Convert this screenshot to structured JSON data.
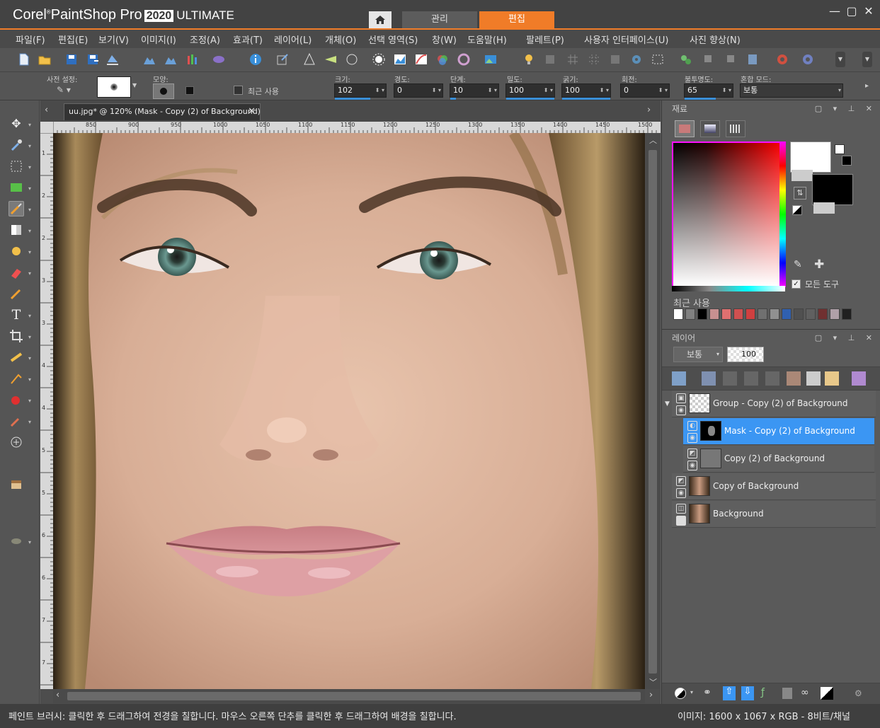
{
  "app": {
    "logo_corel": "Corel",
    "logo_product": "PaintShop Pro",
    "logo_year": "2020",
    "logo_edition": "ULTIMATE"
  },
  "workspace_tabs": {
    "manage": "관리",
    "edit": "편집"
  },
  "window_controls": {
    "minimize": "—",
    "maximize": "▢",
    "close": "✕"
  },
  "menu": [
    "파일(F)",
    "편집(E)",
    "보기(V)",
    "이미지(I)",
    "조정(A)",
    "효과(T)",
    "레이어(L)",
    "개체(O)",
    "선택 영역(S)",
    "창(W)",
    "도움말(H)",
    "팔레트(P)",
    "사용자 인터페이스(U)",
    "사진 향상(N)"
  ],
  "options": {
    "preset_label": "사전 설정:",
    "shape_label": "모양:",
    "recent_use_label": "최근 사용",
    "size_label": "크기:",
    "size_value": "102",
    "hardness_label": "경도:",
    "hardness_value": "0",
    "step_label": "단계:",
    "step_value": "10",
    "density_label": "밀도:",
    "density_value": "100",
    "thickness_label": "굵기:",
    "thickness_value": "100",
    "rotation_label": "회전:",
    "rotation_value": "0",
    "opacity_label": "불투명도:",
    "opacity_value": "65",
    "blend_label": "혼합 모드:",
    "blend_value": "보통"
  },
  "document": {
    "tab_title": "uu.jpg* @ 120% (Mask - Copy (2) of Background)",
    "ruler_h": [
      "850",
      "900",
      "950",
      "1000",
      "1050",
      "1100",
      "1150",
      "1200",
      "1250",
      "1300",
      "1350",
      "1400",
      "1450",
      "1500"
    ],
    "ruler_v": [
      "1",
      "2",
      "2",
      "3",
      "3",
      "4",
      "4",
      "5",
      "5",
      "6",
      "6",
      "7",
      "7"
    ]
  },
  "materials": {
    "title": "재료",
    "all_tools_label": "모든 도구",
    "recent_label": "최근 사용",
    "recent_colors": [
      "#ffffff",
      "#808080",
      "#000000",
      "#c89090",
      "#e07070",
      "#d05050",
      "#d04040",
      "#707070",
      "#909090",
      "#3060b0",
      "#505050",
      "#606060",
      "#703030",
      "#b0a0a8",
      "#202020"
    ]
  },
  "layers": {
    "title": "레이어",
    "blend_value": "보통",
    "opacity_value": "100",
    "items": [
      {
        "name": "Group - Copy (2) of Background",
        "selected": false
      },
      {
        "name": "Mask - Copy (2) of Background",
        "selected": true
      },
      {
        "name": "Copy (2) of Background",
        "selected": false
      },
      {
        "name": "Copy of Background",
        "selected": false
      },
      {
        "name": "Background",
        "selected": false
      }
    ]
  },
  "status": {
    "hint": "페인트 브러시: 클릭한 후 드래그하여 전경을 칠합니다. 마우스 오른쪽 단추를 클릭한 후 드래그하여 배경을 칠합니다.",
    "image_info": "이미지:  1600 x 1067 x RGB - 8비트/채널"
  },
  "colors": {
    "accent": "#f07c28",
    "selection": "#3b96f3"
  }
}
